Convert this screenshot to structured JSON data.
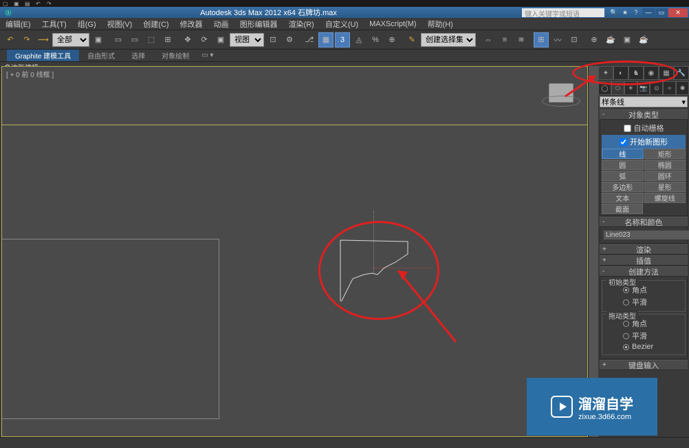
{
  "title": "Autodesk 3ds Max  2012 x64     石牌坊.max",
  "search_placeholder": "键入关键字或短语",
  "menu": [
    "编辑(E)",
    "工具(T)",
    "组(G)",
    "视图(V)",
    "创建(C)",
    "修改器",
    "动画",
    "图形编辑器",
    "渲染(R)",
    "自定义(U)",
    "MAXScript(M)",
    "帮助(H)"
  ],
  "toolbar": {
    "layer_sel": "全部",
    "viewlabel_sel": "视图",
    "selset_sel": "创建选择集"
  },
  "ribbon_tabs": [
    "Graphite 建模工具",
    "自由形式",
    "选择",
    "对象绘制"
  ],
  "subribbon": "多边形建模",
  "viewport_label": "[ + 0 前 0 线框 ]",
  "cmd": {
    "dropdown": "样条线",
    "rollout_objtype": "对象类型",
    "autoGrid": "自动栅格",
    "startNew": "开始新图形",
    "buttons": {
      "line": "线",
      "rect": "矩形",
      "circle": "圆",
      "ellipse": "椭圆",
      "arc": "弧",
      "donut": "圆环",
      "ngon": "多边形",
      "star": "星形",
      "text": "文本",
      "helix": "螺旋线",
      "section": "截面"
    },
    "rollout_name": "名称和颜色",
    "obj_name": "Line023",
    "rollout_render": "渲染",
    "rollout_interp": "插值",
    "rollout_create": "创建方法",
    "init_type": "初始类型",
    "drag_type": "拖动类型",
    "r_corner": "角点",
    "r_smooth": "平滑",
    "r_bezier": "Bezier",
    "rollout_keyboard": "键盘输入"
  },
  "watermark": {
    "big": "溜溜自学",
    "small": "zixue.3d66.com"
  }
}
